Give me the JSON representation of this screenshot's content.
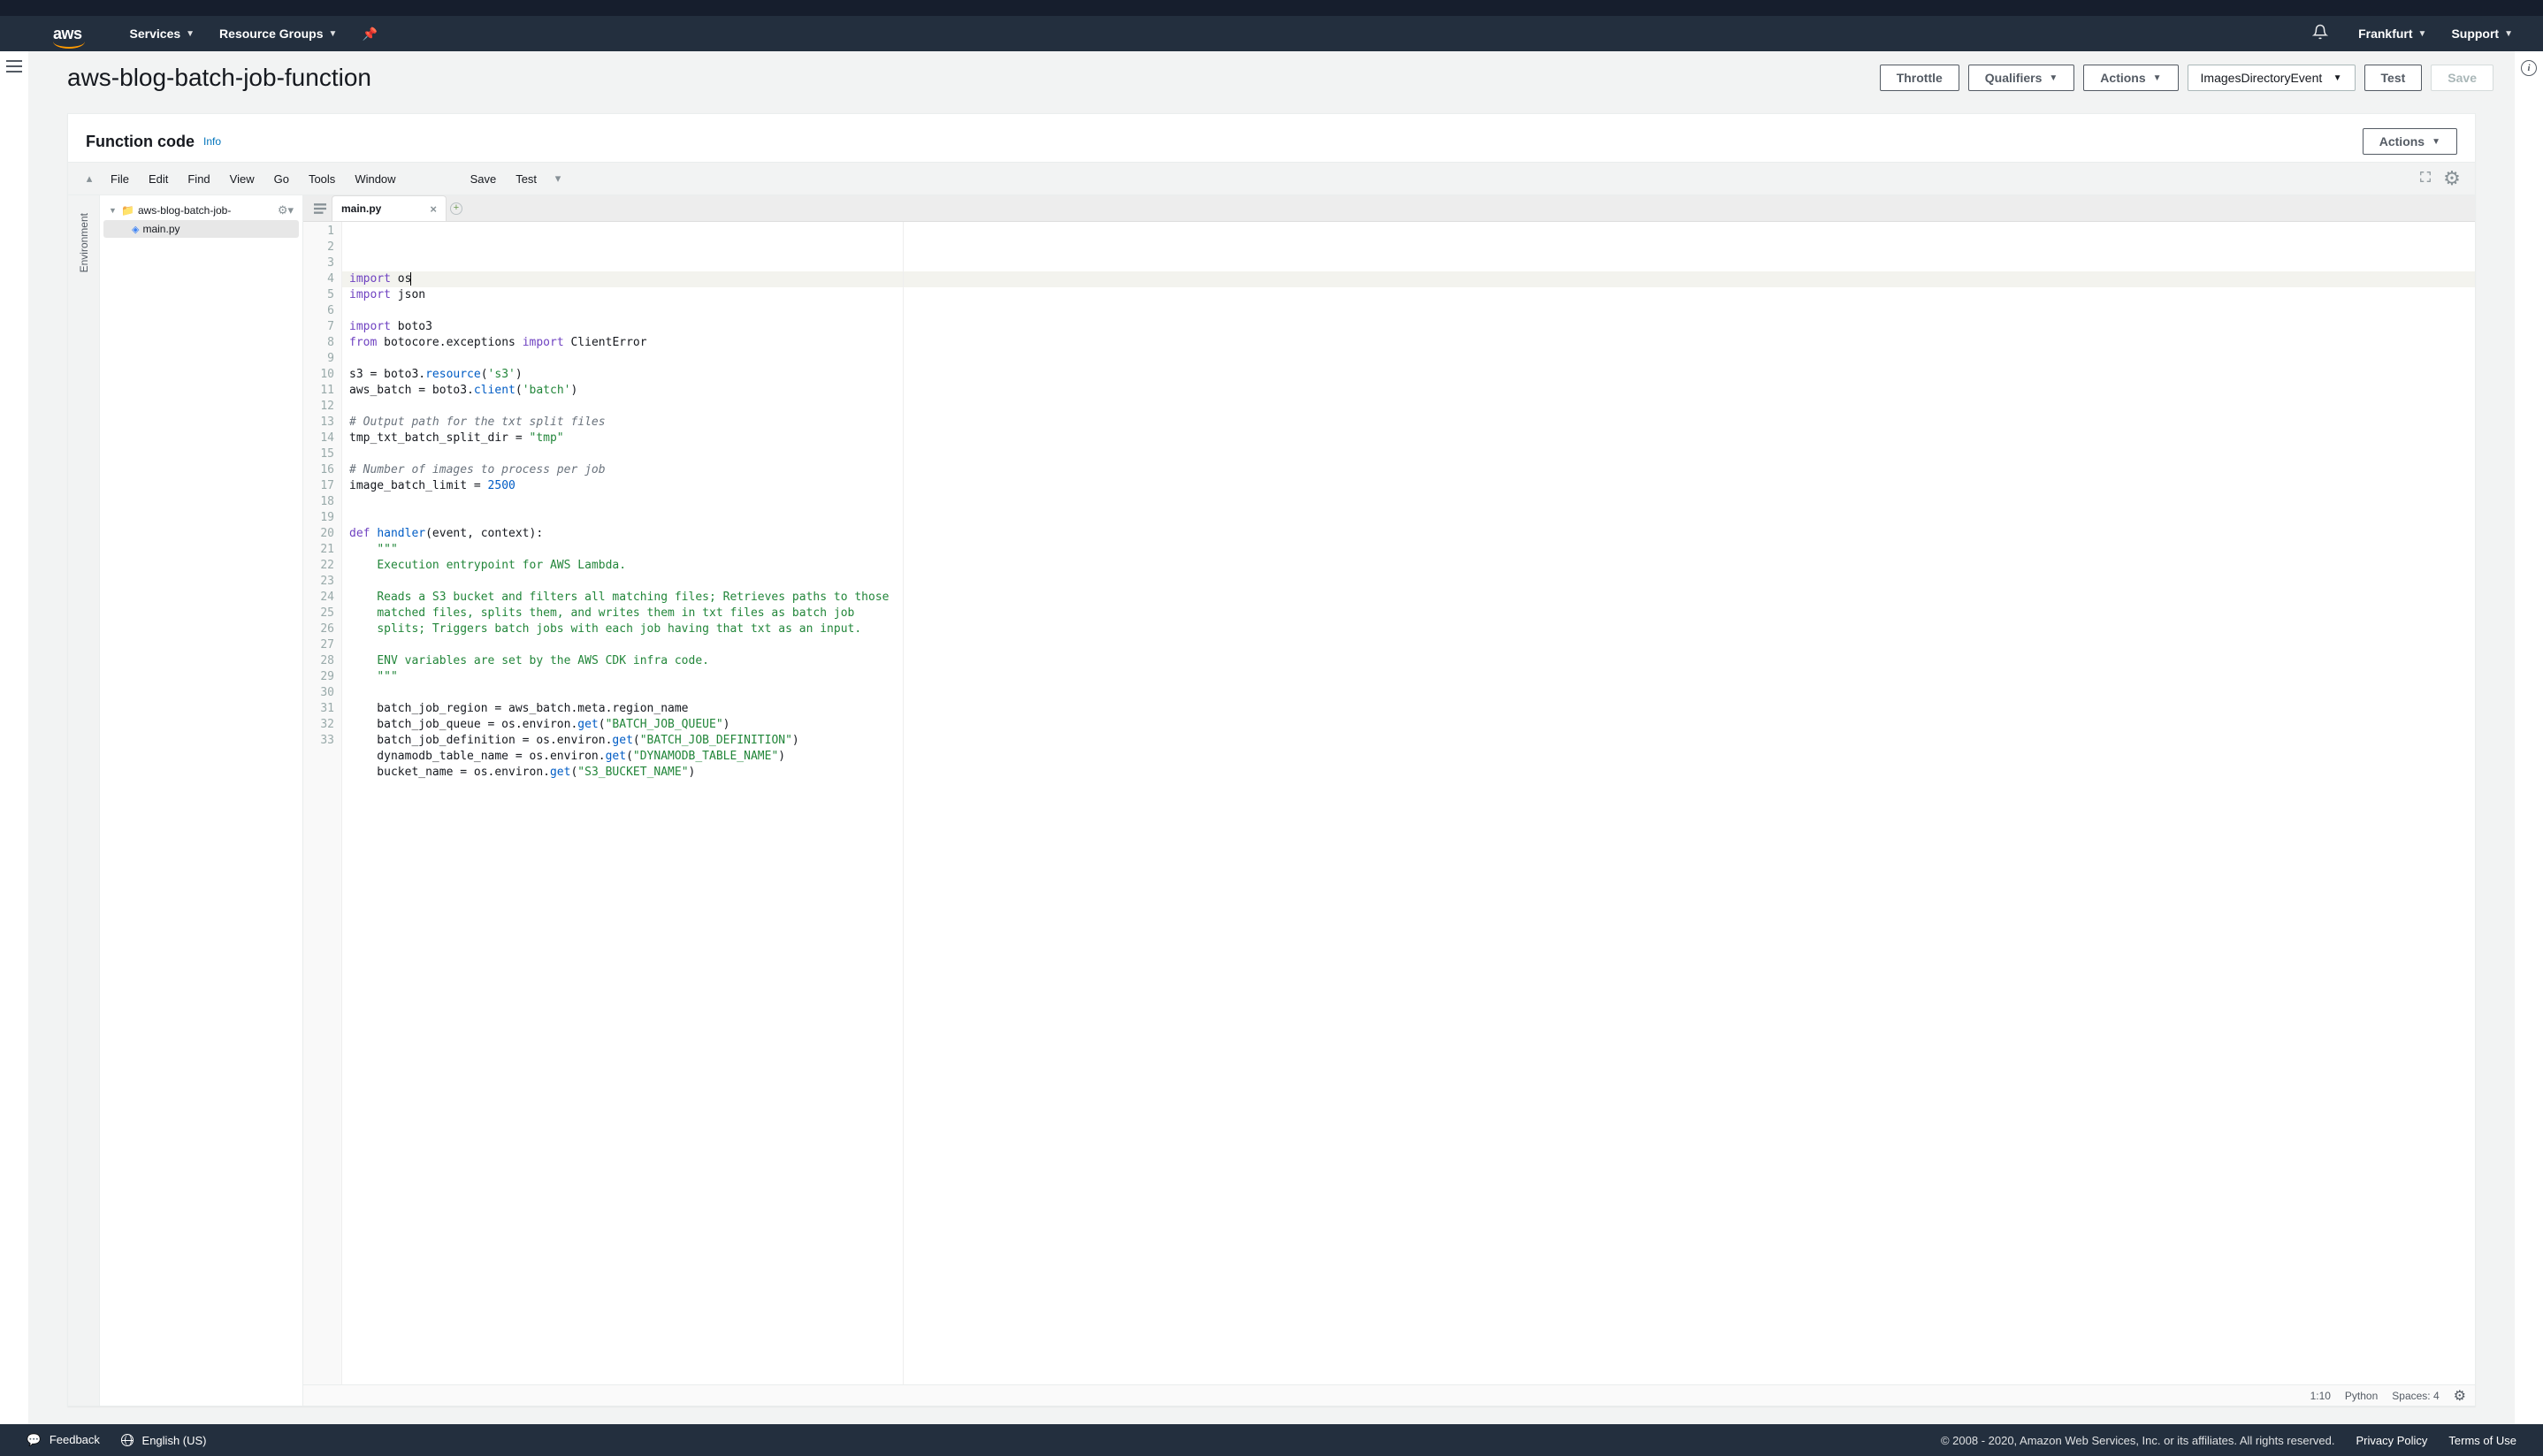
{
  "nav": {
    "logo": "aws",
    "services": "Services",
    "resource_groups": "Resource Groups",
    "region": "Frankfurt",
    "support": "Support"
  },
  "page": {
    "title": "aws-blog-batch-job-function",
    "throttle": "Throttle",
    "qualifiers": "Qualifiers",
    "actions": "Actions",
    "test_event_selected": "ImagesDirectoryEvent",
    "test": "Test",
    "save": "Save"
  },
  "card": {
    "title": "Function code",
    "info": "Info",
    "actions": "Actions"
  },
  "ide": {
    "menu": [
      "File",
      "Edit",
      "Find",
      "View",
      "Go",
      "Tools",
      "Window"
    ],
    "btn_save": "Save",
    "btn_test": "Test",
    "sidebar_tab": "Environment",
    "tree": {
      "root": "aws-blog-batch-job-",
      "file": "main.py"
    },
    "tab": "main.py",
    "status": {
      "pos": "1:10",
      "lang": "Python",
      "spaces": "Spaces: 4"
    },
    "code_lines": [
      [
        [
          "kw",
          "import"
        ],
        [
          "",
          " os"
        ]
      ],
      [
        [
          "kw",
          "import"
        ],
        [
          "",
          " json"
        ]
      ],
      [
        [
          "",
          ""
        ]
      ],
      [
        [
          "kw",
          "import"
        ],
        [
          "",
          " boto3"
        ]
      ],
      [
        [
          "kw",
          "from"
        ],
        [
          "",
          " botocore.exceptions "
        ],
        [
          "kw",
          "import"
        ],
        [
          "",
          " ClientError"
        ]
      ],
      [
        [
          "",
          ""
        ]
      ],
      [
        [
          "",
          "s3 = boto3."
        ],
        [
          "fn",
          "resource"
        ],
        [
          "",
          "("
        ],
        [
          "str",
          "'s3'"
        ],
        [
          "",
          ")"
        ]
      ],
      [
        [
          "",
          "aws_batch = boto3."
        ],
        [
          "fn",
          "client"
        ],
        [
          "",
          "("
        ],
        [
          "str",
          "'batch'"
        ],
        [
          "",
          ")"
        ]
      ],
      [
        [
          "",
          ""
        ]
      ],
      [
        [
          "cmt",
          "# Output path for the txt split files"
        ]
      ],
      [
        [
          "",
          "tmp_txt_batch_split_dir = "
        ],
        [
          "str",
          "\"tmp\""
        ]
      ],
      [
        [
          "",
          ""
        ]
      ],
      [
        [
          "cmt",
          "# Number of images to process per job"
        ]
      ],
      [
        [
          "",
          "image_batch_limit = "
        ],
        [
          "num",
          "2500"
        ]
      ],
      [
        [
          "",
          ""
        ]
      ],
      [
        [
          "",
          ""
        ]
      ],
      [
        [
          "kw",
          "def"
        ],
        [
          "",
          " "
        ],
        [
          "fn",
          "handler"
        ],
        [
          "",
          "(event, context):"
        ]
      ],
      [
        [
          "",
          "    "
        ],
        [
          "docstr",
          "\"\"\""
        ]
      ],
      [
        [
          "",
          "    "
        ],
        [
          "docstr",
          "Execution entrypoint for AWS Lambda."
        ]
      ],
      [
        [
          "",
          ""
        ]
      ],
      [
        [
          "",
          "    "
        ],
        [
          "docstr",
          "Reads a S3 bucket and filters all matching files; Retrieves paths to those"
        ]
      ],
      [
        [
          "",
          "    "
        ],
        [
          "docstr",
          "matched files, splits them, and writes them in txt files as batch job"
        ]
      ],
      [
        [
          "",
          "    "
        ],
        [
          "docstr",
          "splits; Triggers batch jobs with each job having that txt as an input."
        ]
      ],
      [
        [
          "",
          ""
        ]
      ],
      [
        [
          "",
          "    "
        ],
        [
          "docstr",
          "ENV variables are set by the AWS CDK infra code."
        ]
      ],
      [
        [
          "",
          "    "
        ],
        [
          "docstr",
          "\"\"\""
        ]
      ],
      [
        [
          "",
          ""
        ]
      ],
      [
        [
          "",
          "    batch_job_region = aws_batch.meta.region_name"
        ]
      ],
      [
        [
          "",
          "    batch_job_queue = os.environ."
        ],
        [
          "fn",
          "get"
        ],
        [
          "",
          "("
        ],
        [
          "str",
          "\"BATCH_JOB_QUEUE\""
        ],
        [
          "",
          ")"
        ]
      ],
      [
        [
          "",
          "    batch_job_definition = os.environ."
        ],
        [
          "fn",
          "get"
        ],
        [
          "",
          "("
        ],
        [
          "str",
          "\"BATCH_JOB_DEFINITION\""
        ],
        [
          "",
          ")"
        ]
      ],
      [
        [
          "",
          "    dynamodb_table_name = os.environ."
        ],
        [
          "fn",
          "get"
        ],
        [
          "",
          "("
        ],
        [
          "str",
          "\"DYNAMODB_TABLE_NAME\""
        ],
        [
          "",
          ")"
        ]
      ],
      [
        [
          "",
          "    bucket_name = os.environ."
        ],
        [
          "fn",
          "get"
        ],
        [
          "",
          "("
        ],
        [
          "str",
          "\"S3_BUCKET_NAME\""
        ],
        [
          "",
          ")"
        ]
      ],
      [
        [
          "",
          ""
        ]
      ]
    ]
  },
  "footer": {
    "feedback": "Feedback",
    "language": "English (US)",
    "copyright": "© 2008 - 2020, Amazon Web Services, Inc. or its affiliates. All rights reserved.",
    "privacy": "Privacy Policy",
    "terms": "Terms of Use"
  }
}
